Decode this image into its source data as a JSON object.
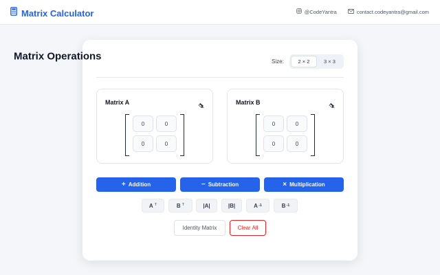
{
  "header": {
    "app_title": "Matrix Calculator",
    "handle": "@CodeYantra",
    "email": "contact.codeyantra@gmail.com"
  },
  "card": {
    "title": "Matrix Operations",
    "size_label": "Size:",
    "size_options": [
      "2 × 2",
      "3 × 3"
    ],
    "size_selected": "2 × 2"
  },
  "matrix_a": {
    "title": "Matrix A",
    "values": [
      "0",
      "0",
      "0",
      "0"
    ]
  },
  "matrix_b": {
    "title": "Matrix B",
    "values": [
      "0",
      "0",
      "0",
      "0"
    ]
  },
  "operations": [
    {
      "symbol": "+",
      "label": "Addition"
    },
    {
      "symbol": "−",
      "label": "Subtraction"
    },
    {
      "symbol": "×",
      "label": "Multiplication"
    }
  ],
  "secondary_ops": {
    "a_transpose": {
      "base": "A",
      "sup": "T"
    },
    "b_transpose": {
      "base": "B",
      "sup": "T"
    },
    "det_a": "|A|",
    "det_b": "|B|",
    "a_inverse": {
      "base": "A",
      "sup": "-1"
    },
    "b_inverse": {
      "base": "B",
      "sup": "-1"
    }
  },
  "footer_buttons": {
    "identity": "Identity Matrix",
    "clear": "Clear All"
  },
  "colors": {
    "accent": "#2563eb",
    "danger": "#dc2626",
    "background": "#f4f6f9"
  },
  "icons": {
    "logo": "calculator-icon",
    "handle": "instagram-icon",
    "email": "mail-icon",
    "clear_matrix": "eraser-icon"
  }
}
